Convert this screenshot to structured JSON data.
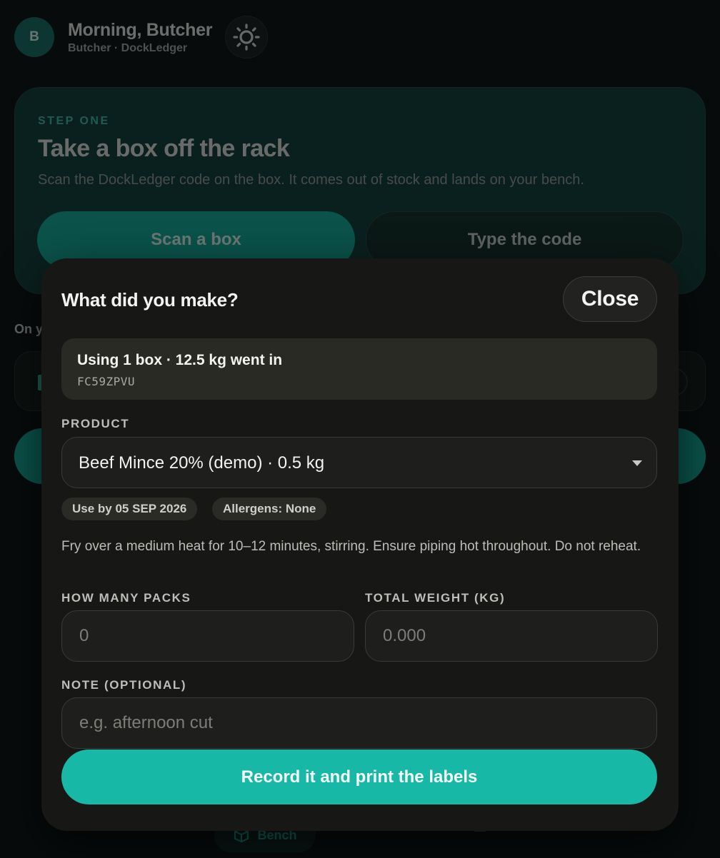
{
  "header": {
    "avatar_initial": "B",
    "greeting": "Morning, Butcher",
    "subtitle": "Butcher · DockLedger",
    "theme_icon": "sun-icon"
  },
  "step_card": {
    "label": "STEP ONE",
    "title": "Take a box off the rack",
    "description": "Scan the DockLedger code on the box. It comes out of stock and lands on your bench.",
    "scan_label": "Scan a box",
    "type_label": "Type the code"
  },
  "bench": {
    "label": "On y"
  },
  "bottom_nav": {
    "bench_label": "Bench",
    "bench_icon": "box-icon"
  },
  "modal": {
    "title": "What did you make?",
    "close_label": "Close",
    "summary": {
      "main": "Using 1 box · 12.5 kg went in",
      "code": "FC59ZPVU"
    },
    "product": {
      "label": "PRODUCT",
      "selected": "Beef Mince 20% (demo) · 0.5 kg"
    },
    "chips": {
      "use_by": "Use by 05 SEP 2026",
      "allergens": "Allergens: None"
    },
    "instructions": "Fry over a medium heat for 10–12 minutes, stirring. Ensure piping hot throughout. Do not reheat.",
    "packs": {
      "label": "HOW MANY PACKS",
      "placeholder": "0"
    },
    "weight": {
      "label": "TOTAL WEIGHT (KG)",
      "placeholder": "0.000"
    },
    "note": {
      "label": "NOTE (OPTIONAL)",
      "placeholder": "e.g. afternoon cut"
    },
    "submit_label": "Record it and print the labels"
  },
  "colors": {
    "accent": "#17b8a6",
    "modal_bg": "#171716",
    "page_bg": "#0f1716"
  }
}
